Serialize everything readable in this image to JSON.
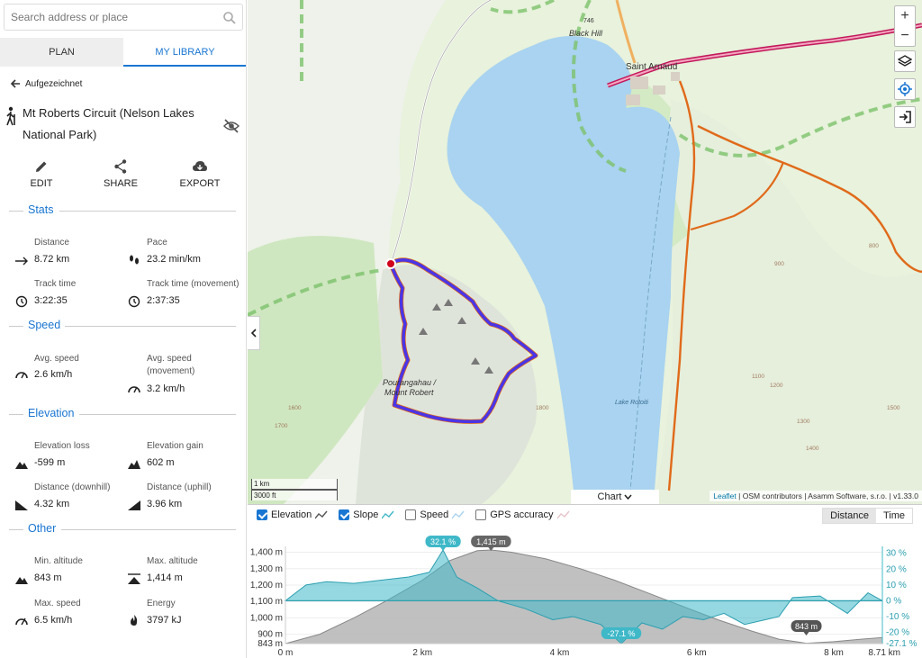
{
  "search": {
    "placeholder": "Search address or place"
  },
  "tabs": {
    "plan": "PLAN",
    "library": "MY LIBRARY"
  },
  "back_label": "Aufgezeichnet",
  "route": {
    "title": "Mt Roberts Circuit (Nelson Lakes National Park)"
  },
  "actions": {
    "edit": "EDIT",
    "share": "SHARE",
    "export": "EXPORT"
  },
  "sections": {
    "stats": "Stats",
    "speed": "Speed",
    "elevation": "Elevation",
    "other": "Other"
  },
  "stats": {
    "distance": {
      "label": "Distance",
      "value": "8.72 km"
    },
    "pace": {
      "label": "Pace",
      "value": "23.2 min/km"
    },
    "track_time": {
      "label": "Track time",
      "value": "3:22:35"
    },
    "track_time_movement": {
      "label": "Track time (movement)",
      "value": "2:37:35"
    }
  },
  "speed": {
    "avg": {
      "label": "Avg. speed",
      "value": "2.6 km/h"
    },
    "avg_movement": {
      "label": "Avg. speed (movement)",
      "value": "3.2 km/h"
    }
  },
  "elevation": {
    "loss": {
      "label": "Elevation loss",
      "value": "-599 m"
    },
    "gain": {
      "label": "Elevation gain",
      "value": "602 m"
    },
    "downhill": {
      "label": "Distance (downhill)",
      "value": "4.32 km"
    },
    "uphill": {
      "label": "Distance (uphill)",
      "value": "3.96 km"
    }
  },
  "other": {
    "min_alt": {
      "label": "Min. altitude",
      "value": "843 m"
    },
    "max_alt": {
      "label": "Max. altitude",
      "value": "1,414 m"
    },
    "max_speed": {
      "label": "Max. speed",
      "value": "6.5 km/h"
    },
    "energy": {
      "label": "Energy",
      "value": "3797 kJ"
    }
  },
  "map": {
    "labels": {
      "town": "Saint Arnaud",
      "hill": "Black Hill",
      "hill_elev": "746",
      "peak_1": "Pourangahau /",
      "peak_2": "Mount Robert",
      "lake": "Lake Rotoiti"
    },
    "contours": [
      "900",
      "800",
      "1100",
      "1200",
      "1300",
      "1400",
      "1500",
      "1600",
      "1700",
      "1800"
    ],
    "scale_km": "1 km",
    "scale_ft": "3000 ft",
    "chart_tab": "Chart",
    "attribution_leaflet": "Leaflet",
    "attribution_rest": "| OSM contributors | Asamm Software, s.r.o. |",
    "version": "v1.33.0",
    "zoom_in": "+",
    "zoom_out": "−",
    "colors": {
      "water": "#a9d3f0",
      "land": "#e4f0d6",
      "route": "#4a35e6",
      "trail": "#e06a1a",
      "park_border": "#7cc26b"
    }
  },
  "chart_legend": {
    "elevation": "Elevation",
    "slope": "Slope",
    "speed": "Speed",
    "gps": "GPS accuracy",
    "distance": "Distance",
    "time": "Time"
  },
  "chart_data": {
    "type": "area",
    "x_unit": "km",
    "x_ticks": [
      "0 m",
      "2 km",
      "4 km",
      "6 km",
      "8 km",
      "8.71 km"
    ],
    "x_tick_values": [
      0,
      2,
      4,
      6,
      8,
      8.71
    ],
    "y_left_ticks": [
      "1,400 m",
      "1,300 m",
      "1,200 m",
      "1,100 m",
      "1,000 m",
      "900 m",
      "843 m"
    ],
    "y_left_values": [
      1400,
      1300,
      1200,
      1100,
      1000,
      900,
      843
    ],
    "y_right_ticks": [
      "30 %",
      "20 %",
      "10 %",
      "0 %",
      "-10 %",
      "-20 %",
      "-27.1 %"
    ],
    "y_right_values": [
      30,
      20,
      10,
      0,
      -10,
      -20,
      -27.1
    ],
    "ylim_elevation": [
      843,
      1414
    ],
    "ylim_slope": [
      -27.1,
      32.1
    ],
    "series": [
      {
        "name": "Elevation",
        "color": "#888888",
        "x": [
          0,
          0.5,
          1.0,
          1.5,
          2.0,
          2.4,
          2.8,
          3.0,
          3.3,
          3.8,
          4.3,
          4.8,
          5.3,
          5.8,
          6.3,
          6.8,
          7.2,
          7.6,
          8.0,
          8.4,
          8.71
        ],
        "y": [
          843,
          900,
          1000,
          1110,
          1230,
          1350,
          1410,
          1414,
          1400,
          1360,
          1300,
          1230,
          1150,
          1070,
          990,
          920,
          870,
          845,
          855,
          870,
          880
        ]
      },
      {
        "name": "Slope",
        "color": "#3fb8c8",
        "x": [
          0,
          0.3,
          0.6,
          1.0,
          1.4,
          1.8,
          2.1,
          2.3,
          2.5,
          2.8,
          3.1,
          3.5,
          3.9,
          4.2,
          4.6,
          4.9,
          5.2,
          5.5,
          5.8,
          6.1,
          6.4,
          6.7,
          7.0,
          7.2,
          7.4,
          7.8,
          8.2,
          8.5,
          8.71
        ],
        "y": [
          0,
          10,
          12,
          11,
          13,
          15,
          18,
          32.1,
          15,
          8,
          0,
          -5,
          -12,
          -10,
          -15,
          -27.1,
          -14,
          -18,
          -10,
          -12,
          -8,
          -15,
          -12,
          -10,
          2,
          3,
          -8,
          5,
          0
        ]
      }
    ],
    "markers": [
      {
        "label": "32.1 %",
        "x": 2.3
      },
      {
        "label": "1,415 m",
        "x": 3.0
      },
      {
        "label": "-27.1 %",
        "x": 4.9
      },
      {
        "label": "843 m",
        "x": 7.6
      }
    ]
  }
}
